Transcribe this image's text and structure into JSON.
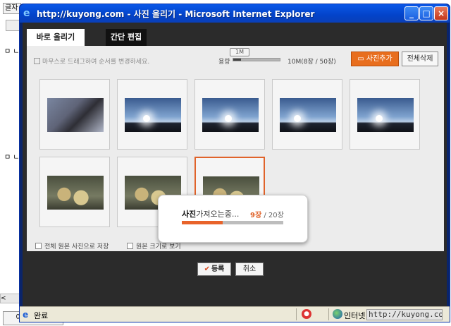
{
  "background_page": {
    "tab_label": "글자",
    "bullets": [
      "ㅁ ㄴ",
      "ㅁ ㄴ"
    ],
    "scroll_arrow": "<",
    "bottom_button": "이전글 보기"
  },
  "window": {
    "title": "http://kuyong.com - 사진 올리기 - Microsoft Internet Explorer",
    "minimize": "_",
    "maximize": "□",
    "close": "×"
  },
  "tabs": [
    {
      "label": "바로 올리기",
      "active": true
    },
    {
      "label": "간단 편집",
      "active": false
    }
  ],
  "toolbar": {
    "hint": "마우스로 드래그하여 순서를 변경하세요.",
    "usage_label": "용량",
    "usage_tip": "1M",
    "usage_fraction": 0.16,
    "usage_text": "10M(8장 / 50장)",
    "add_photo": "사진추가",
    "delete_all": "전체삭제"
  },
  "photos": [
    {
      "kind": "person",
      "selected": false
    },
    {
      "kind": "sky",
      "selected": false
    },
    {
      "kind": "sky",
      "selected": false
    },
    {
      "kind": "sky",
      "selected": false
    },
    {
      "kind": "sky",
      "selected": false
    },
    {
      "kind": "food",
      "selected": false
    },
    {
      "kind": "food",
      "selected": false
    },
    {
      "kind": "food",
      "selected": true
    }
  ],
  "options": {
    "save_original": "전체 원본 사진으로 저장",
    "original_size": "원본 크기로 보기"
  },
  "buttons": {
    "register": "등록",
    "cancel": "취소"
  },
  "progress": {
    "label_bold": "사진",
    "label_rest": "가져오는중...",
    "current": "9장",
    "total": "/ 20장",
    "fraction": 0.4
  },
  "statusbar": {
    "text": "완료",
    "zone": "인터넷",
    "url": "http://kuyong.com"
  },
  "colors": {
    "accent": "#e8632a",
    "titlebar": "#0a58e8"
  }
}
